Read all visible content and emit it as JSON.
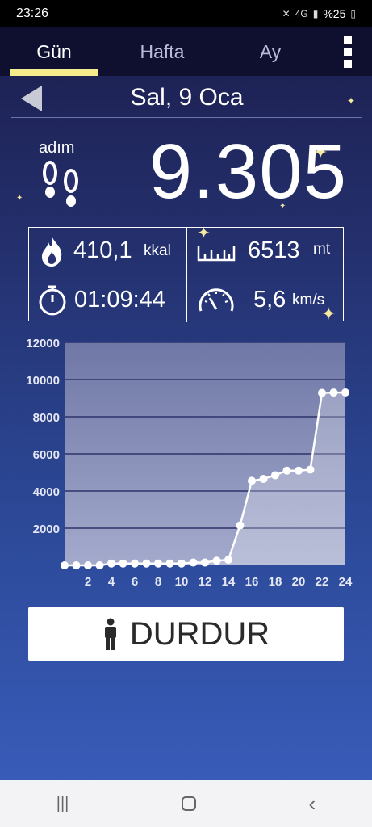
{
  "status_bar": {
    "time": "23:26",
    "battery": "%25",
    "network": "4G"
  },
  "tabs": [
    {
      "label": "Gün",
      "active": true
    },
    {
      "label": "Hafta",
      "active": false
    },
    {
      "label": "Ay",
      "active": false
    }
  ],
  "date_label": "Sal, 9 Oca",
  "steps": {
    "label": "adım",
    "value": "9.305"
  },
  "stats": {
    "calories": {
      "value": "410,1",
      "unit": "kkal"
    },
    "distance": {
      "value": "6513",
      "unit": "mt"
    },
    "duration": {
      "value": "01:09:44"
    },
    "speed": {
      "value": "5,6",
      "unit": "km/s"
    }
  },
  "stop_button": {
    "label": "DURDUR"
  },
  "colors": {
    "tab_indicator": "#f4ec8c",
    "chart_area_top": "#6f77a6",
    "chart_area_bottom": "#a3aacc"
  },
  "chart_data": {
    "type": "line",
    "x": [
      0,
      1,
      2,
      3,
      4,
      5,
      6,
      7,
      8,
      9,
      10,
      11,
      12,
      13,
      14,
      15,
      16,
      17,
      18,
      19,
      20,
      21,
      22,
      23,
      24
    ],
    "values": [
      0,
      0,
      0,
      0,
      100,
      100,
      100,
      100,
      100,
      100,
      100,
      150,
      150,
      250,
      300,
      2150,
      4550,
      4650,
      4850,
      5100,
      5100,
      5150,
      9280,
      9300,
      9305
    ],
    "xticks": [
      "2",
      "4",
      "6",
      "8",
      "10",
      "12",
      "14",
      "16",
      "18",
      "20",
      "22",
      "24"
    ],
    "yticks": [
      "2000",
      "4000",
      "6000",
      "8000",
      "10000",
      "12000"
    ],
    "xlim": [
      0,
      24
    ],
    "ylim": [
      0,
      12000
    ],
    "grid": true,
    "title": "",
    "xlabel": "",
    "ylabel": ""
  }
}
